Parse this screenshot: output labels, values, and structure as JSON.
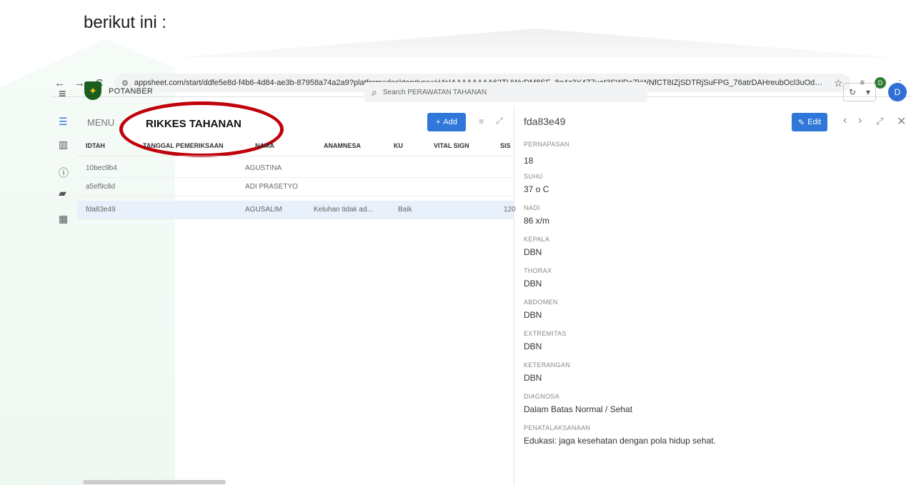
{
  "document_text": "berikut ini :",
  "browser": {
    "back": "←",
    "forward": "→",
    "reload": "C",
    "url": "appsheet.com/start/ddfe5e8d-f4b6-4d84-ae3b-87958a74a2a9?platform=desktop#vss=H4sIAAAAAAAA62TUWuDM8SF_8q4z3Y4Z7uat3SWDcZkWNfCT8IZjSDTRjSuFPG_76atrDAHreubOcl3uOdwr...",
    "profile_initial": "D"
  },
  "app": {
    "name": "POTANBER",
    "search_placeholder": "Search PERAWATAN TAHANAN",
    "avatar_initial": "D"
  },
  "list": {
    "menu_label": "MENU",
    "highlight_title": "RIKKES TAHANAN",
    "add_label": "Add",
    "columns": [
      "IDTAH",
      "TANGGAL PEMERIKSAAN",
      "NAMA",
      "ANAMNESA",
      "KU",
      "VITAL SIGN",
      "SIS"
    ],
    "rows": [
      {
        "id": "10bec9b4",
        "tanggal": "",
        "nama": "AGUSTINA",
        "anamnesa": "",
        "ku": "",
        "vital": "",
        "sis": ""
      },
      {
        "id": "a5ef9c8d",
        "tanggal": "",
        "nama": "ADI PRASETYO",
        "anamnesa": "",
        "ku": "",
        "vital": "",
        "sis": ""
      },
      {
        "id": "fda83e49",
        "tanggal": "",
        "nama": "AGUSALIM",
        "anamnesa": "Keluhan tidak ad...",
        "ku": "Baik",
        "vital": "",
        "sis": "120"
      }
    ]
  },
  "detail": {
    "title": "fda83e49",
    "edit_label": "Edit",
    "fields": [
      {
        "label": "PERNAPASAN",
        "value": "18"
      },
      {
        "label": "SUHU",
        "value": "37 o C"
      },
      {
        "label": "NADI",
        "value": "86 x/m"
      },
      {
        "label": "KEPALA",
        "value": "DBN"
      },
      {
        "label": "THORAX",
        "value": "DBN"
      },
      {
        "label": "ABDOMEN",
        "value": "DBN"
      },
      {
        "label": "EXTREMITAS",
        "value": "DBN"
      },
      {
        "label": "KETERANGAN",
        "value": "DBN"
      },
      {
        "label": "DIAGNOSA",
        "value": "Dalam Batas Normal / Sehat"
      },
      {
        "label": "PENATALAKSANAAN",
        "value": "Edukasi: jaga kesehatan dengan pola hidup sehat."
      }
    ]
  }
}
